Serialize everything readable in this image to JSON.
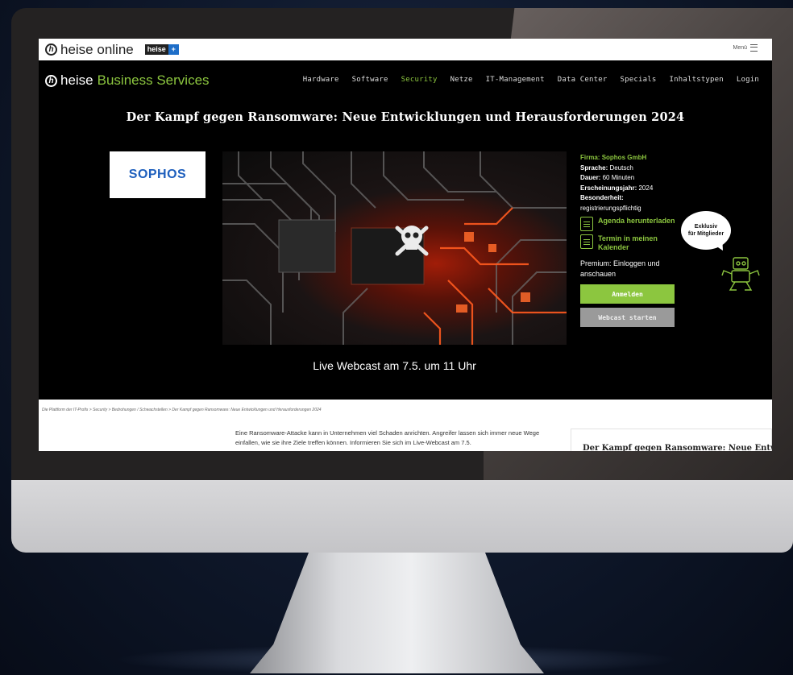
{
  "topbar": {
    "logo_letter": "h",
    "brand": "heise online",
    "plus_badge": "heise",
    "plus_symbol": "+",
    "menu_label": "Menü"
  },
  "navbar": {
    "logo_letter": "h",
    "brand_heise": "heise",
    "brand_rest": "Business Services",
    "links": [
      "Hardware",
      "Software",
      "Security",
      "Netze",
      "IT-Management",
      "Data Center",
      "Specials",
      "Inhaltstypen",
      "Login"
    ],
    "active_link": "Security"
  },
  "hero": {
    "title": "Der Kampf gegen Ransomware: Neue Entwicklungen und Herausforderungen 2024",
    "sponsor_logo": "SOPHOS",
    "webcast_date": "Live Webcast am 7.5. um 11 Uhr"
  },
  "info": {
    "firma_label": "Firma:",
    "firma_value": "Sophos GmbH",
    "sprache_label": "Sprache:",
    "sprache_value": "Deutsch",
    "dauer_label": "Dauer:",
    "dauer_value": "60 Minuten",
    "jahr_label": "Erscheinungsjahr:",
    "jahr_value": "2024",
    "besonderheit_label": "Besonderheit:",
    "besonderheit_value": "registrierungspflichtig",
    "agenda_label": "Agenda herunterladen",
    "termin_label": "Termin in meinen Kalender",
    "premium_text": "Premium: Einloggen und anschauen",
    "anmelden_label": "Anmelden",
    "webcast_label": "Webcast starten"
  },
  "bubble": {
    "line1": "Exklusiv",
    "line2": "für Mitglieder"
  },
  "content": {
    "breadcrumb": "Die Plattform der IT-Profis  >  Security  >  Bedrohungen / Schwachstellen  >  Der Kampf gegen Ransomware: Neue Entwicklungen und Herausforderungen 2024",
    "article_text": "Eine Ransomware-Attacke kann in Unternehmen viel Schaden anrichten. Angreifer lassen sich immer neue Wege einfallen, wie sie ihre Ziele treffen können. Informieren Sie sich im Live-Webcast am 7.5.",
    "side_title": "Der Kampf gegen Ransomware: Neue Entwi"
  },
  "colors": {
    "accent": "#8cc63f",
    "sponsor": "#1e5fbd",
    "plus": "#1e6ec8"
  },
  "icons": [
    "heise-logo-icon",
    "menu-icon",
    "agenda-icon",
    "calendar-icon",
    "skull-icon",
    "robot-icon"
  ]
}
